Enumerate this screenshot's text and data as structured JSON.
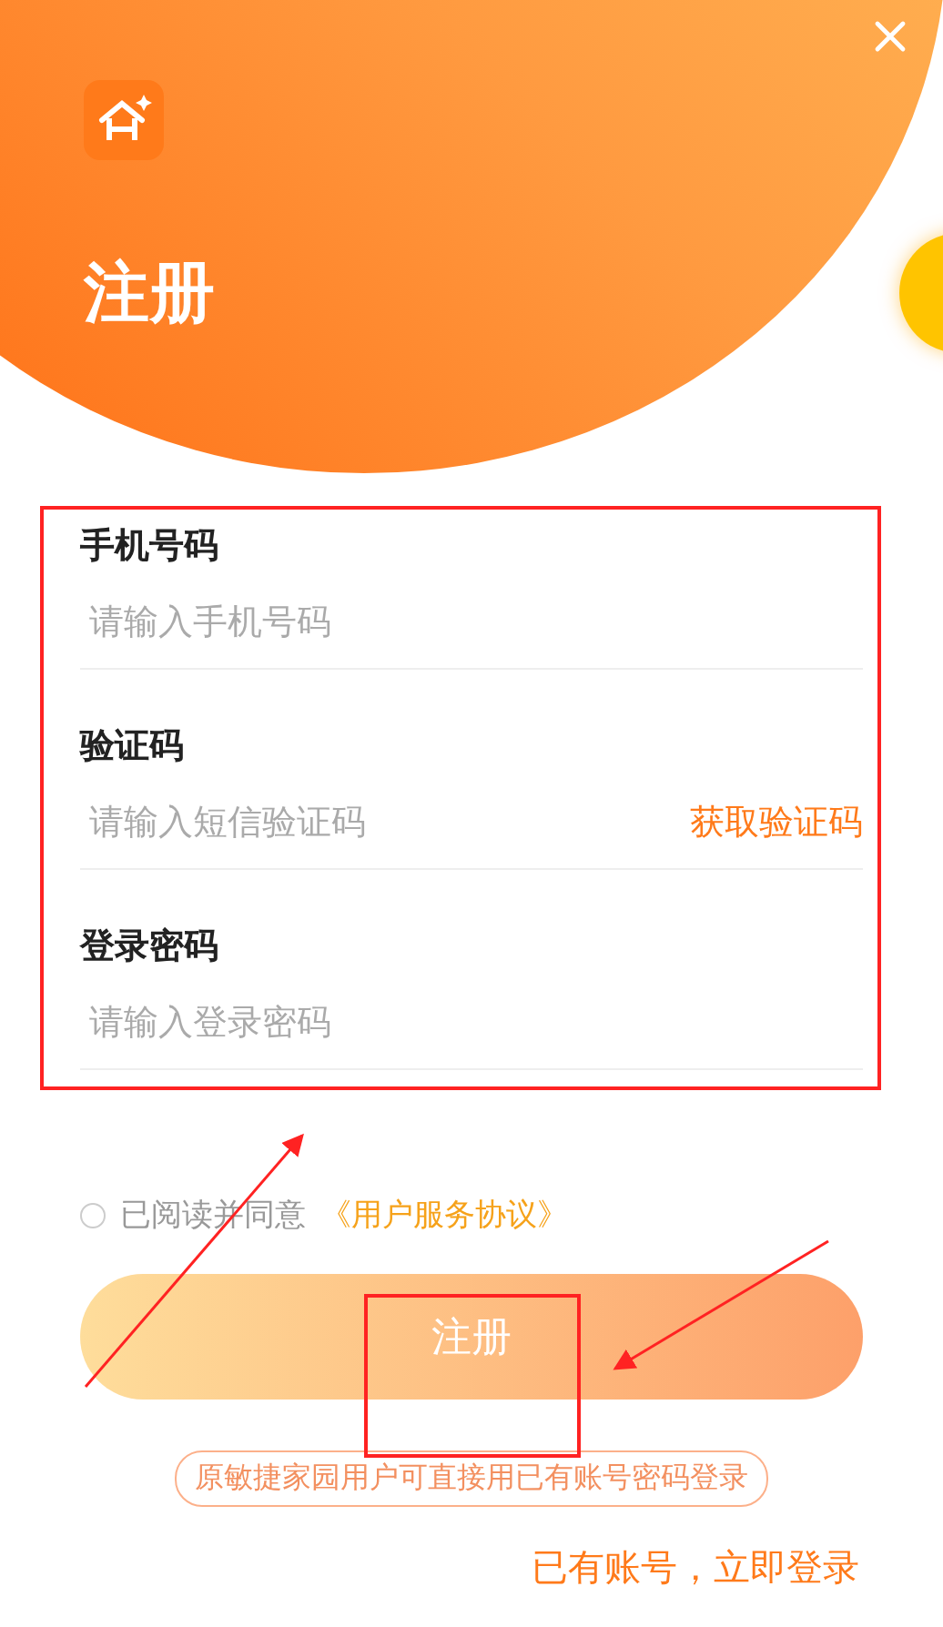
{
  "title": "注册",
  "fields": [
    {
      "label": "手机号码",
      "placeholder": "请输入手机号码"
    },
    {
      "label": "验证码",
      "placeholder": "请输入短信验证码",
      "action": "获取验证码"
    },
    {
      "label": "登录密码",
      "placeholder": "请输入登录密码"
    }
  ],
  "agreement": {
    "checked": false,
    "text": "已阅读并同意",
    "link": "《用户服务协议》"
  },
  "submit": "注册",
  "notice": "原敏捷家园用户可直接用已有账号密码登录",
  "login_prompt": "已有账号，立即登录"
}
